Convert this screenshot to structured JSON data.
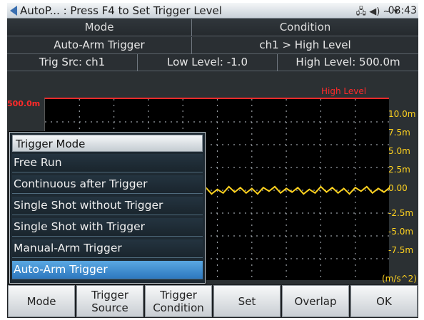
{
  "titlebar": {
    "title": "AutoP... : Press F4 to Set Trigger Level",
    "icons": [
      "back-arrow-icon",
      "connection-icon",
      "speaker-icon",
      "antenna-icon",
      "battery-icon"
    ],
    "icon_glyphs": "🖧 ◀) ~ ▾",
    "clock": "08:43"
  },
  "table": {
    "header_mode": "Mode",
    "header_condition": "Condition",
    "mode_value": "Auto-Arm Trigger",
    "condition_value": "ch1 > High Level",
    "trig_src": "Trig Src: ch1",
    "low_level": "Low Level: -1.0",
    "high_level": "High Level: 500.0m"
  },
  "plot": {
    "high_level_label": "High Level",
    "left_level_label": "500.0m",
    "y_ticks": [
      "10.0m",
      "7.5m",
      "5.0m",
      "2.5m",
      "0.00",
      "-2.5m",
      "-5.0m",
      "-7.5m"
    ],
    "unit": "(m/s^2)",
    "trace_color": "#ffd21f",
    "level_color": "#ff2a2a"
  },
  "chart_data": {
    "type": "line",
    "ylim": [
      -10.0,
      10.0
    ],
    "grid": true,
    "series": [
      {
        "values": [
          0.3,
          -0.2,
          0.4,
          -0.3,
          0.2,
          -0.4,
          0.3,
          -0.1,
          0.4,
          -0.3,
          0.2,
          -0.2,
          0.3,
          -0.4,
          0.1,
          -0.3,
          0.4,
          -0.2,
          0.3,
          -0.3,
          0.2,
          -0.4,
          0.3,
          -0.1,
          0.4,
          -0.3,
          0.2,
          -0.2,
          0.3,
          -0.4,
          0.1,
          -0.3,
          0.4,
          -0.2,
          0.3,
          -0.3,
          0.2,
          -0.4,
          0.3,
          -0.1,
          0.4,
          -0.3,
          0.2,
          -0.2,
          0.3,
          -0.4,
          0.1,
          -0.3,
          0.4,
          -0.2,
          0.3,
          -0.3,
          0.2,
          -0.4,
          0.3,
          -0.1,
          0.4,
          -0.3,
          0.2,
          -0.2,
          0.3
        ]
      }
    ]
  },
  "popup": {
    "title": "Trigger Mode",
    "options": [
      "Free Run",
      "Continuous after Trigger",
      "Single Shot without Trigger",
      "Single Shot with Trigger",
      "Manual-Arm Trigger",
      "Auto-Arm Trigger"
    ],
    "selected_index": 5
  },
  "softkeys": [
    {
      "line1": "Mode",
      "line2": ""
    },
    {
      "line1": "Trigger",
      "line2": "Source"
    },
    {
      "line1": "Trigger",
      "line2": "Condition"
    },
    {
      "line1": "Set",
      "line2": ""
    },
    {
      "line1": "Overlap",
      "line2": ""
    },
    {
      "line1": "OK",
      "line2": ""
    }
  ],
  "colors": {
    "accent": "#3a8fd8",
    "grid": "#9aa0a6"
  }
}
